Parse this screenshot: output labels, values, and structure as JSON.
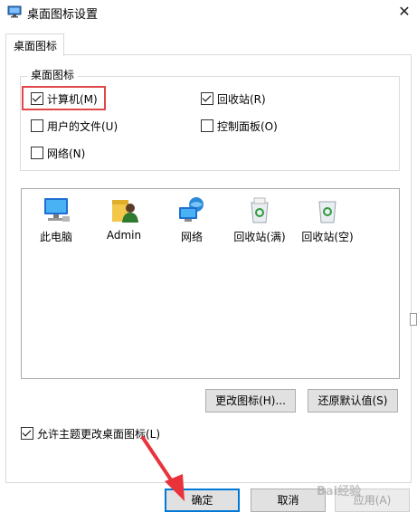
{
  "window": {
    "title": "桌面图标设置",
    "close_glyph": "✕"
  },
  "tab": {
    "label": "桌面图标"
  },
  "group": {
    "title": "桌面图标",
    "checkboxes": [
      {
        "label": "计算机(M)",
        "checked": true
      },
      {
        "label": "回收站(R)",
        "checked": true
      },
      {
        "label": "用户的文件(U)",
        "checked": false
      },
      {
        "label": "控制面板(O)",
        "checked": false
      },
      {
        "label": "网络(N)",
        "checked": false
      }
    ]
  },
  "icons": [
    {
      "label": "此电脑",
      "icon": "computer-icon"
    },
    {
      "label": "Admin",
      "icon": "user-folder-icon"
    },
    {
      "label": "网络",
      "icon": "network-icon"
    },
    {
      "label": "回收站(满)",
      "icon": "recycle-bin-full-icon"
    },
    {
      "label": "回收站(空)",
      "icon": "recycle-bin-empty-icon"
    }
  ],
  "buttons": {
    "change_icon": "更改图标(H)...",
    "restore_default": "还原默认值(S)",
    "ok": "确定",
    "cancel": "取消",
    "apply": "应用(A)"
  },
  "allow_themes": {
    "label": "允许主题更改桌面图标(L)",
    "checked": true
  },
  "colors": {
    "highlight": "#e04848",
    "arrow": "#e8333b",
    "primary_border": "#0078d7"
  },
  "watermark": "Bai经验"
}
